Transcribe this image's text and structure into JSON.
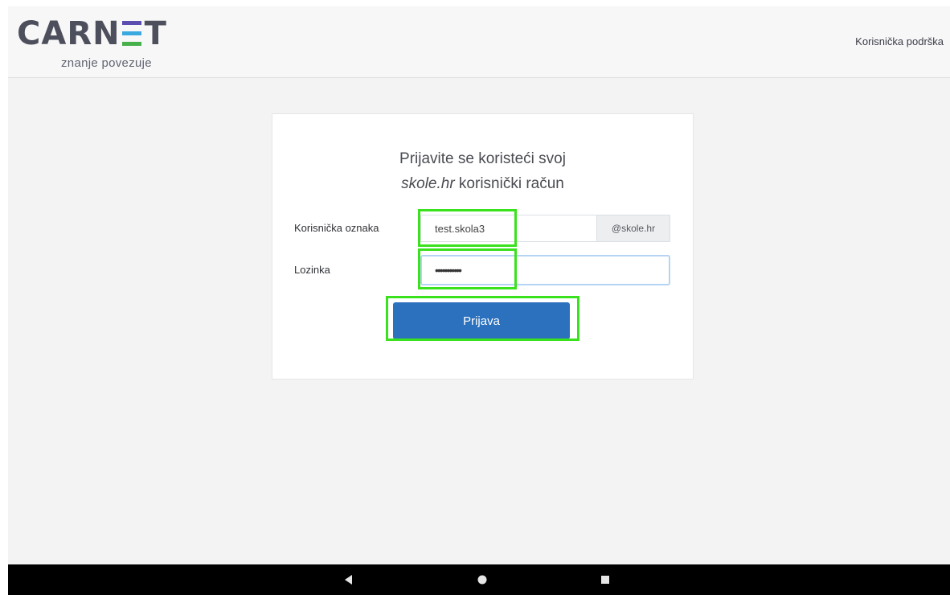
{
  "header": {
    "logo_text_left": "CARN",
    "logo_text_right": "T",
    "logo_tagline": "znanje povezuje",
    "support_link": "Korisnička podrška"
  },
  "login": {
    "title_line1": "Prijavite se koristeći svoj",
    "title_line2_italic": "skole.hr",
    "title_line2_rest": " korisnički račun",
    "username_label": "Korisnička oznaka",
    "username_value": "test.skola3",
    "domain_suffix": "@skole.hr",
    "password_label": "Lozinka",
    "password_value": "skola3test1",
    "submit_label": "Prijava"
  },
  "navbar": {
    "icons": [
      "back-triangle",
      "home-circle",
      "recents-square"
    ]
  },
  "colors": {
    "highlight": "#39e21d",
    "button": "#2b71bd",
    "logo_bars": [
      "#5c4db1",
      "#3aa9e0",
      "#47b04b"
    ]
  }
}
